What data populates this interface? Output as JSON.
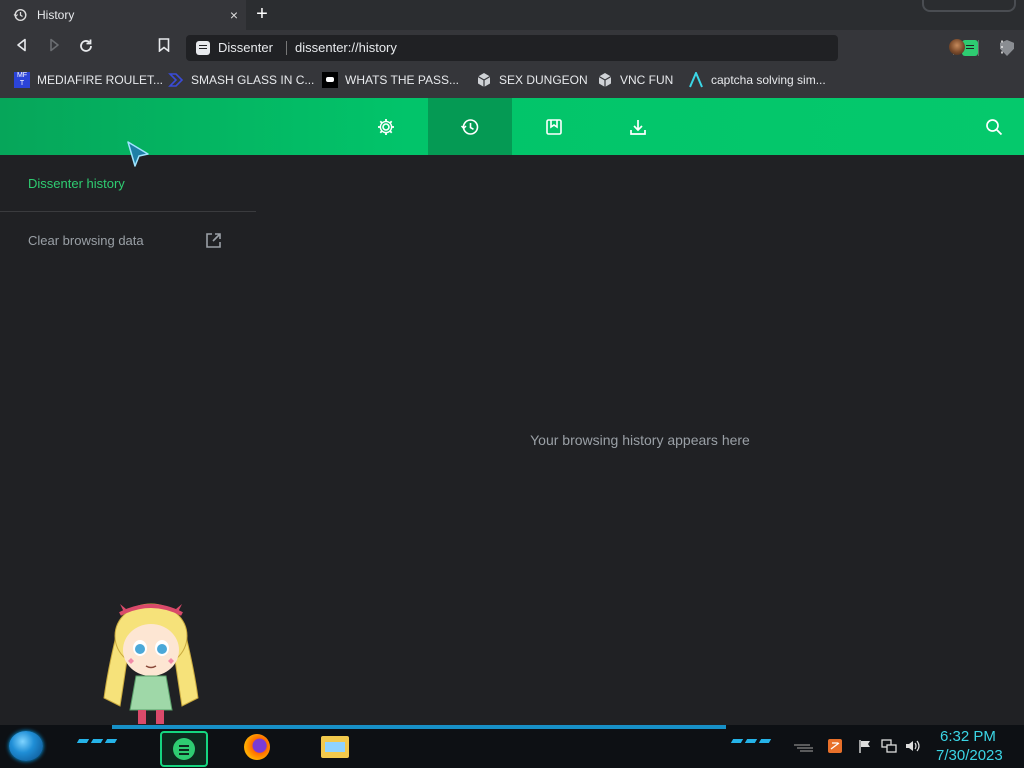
{
  "browser": {
    "tab": {
      "title": "History",
      "icon": "history-icon",
      "close": "×"
    },
    "new_tab": "+",
    "omnibox": {
      "site": "Dissenter",
      "url": "dissenter://history"
    },
    "menu": "⋮"
  },
  "bookmarks": [
    {
      "label": "MEDIAFIRE ROULET...",
      "icon": "mediafire-icon",
      "color": "#2b44d8"
    },
    {
      "label": "SMASH GLASS IN C...",
      "icon": "chevron-icon",
      "color": "#3a4bd8"
    },
    {
      "label": "WHATS THE PASS...",
      "icon": "discord-icon",
      "color": "#ffffff"
    },
    {
      "label": "SEX DUNGEON",
      "icon": "cube-icon",
      "color": "#cfd2d6"
    },
    {
      "label": "VNC FUN",
      "icon": "cube-icon",
      "color": "#cfd2d6"
    },
    {
      "label": "captcha solving sim...",
      "icon": "lambda-icon",
      "color": "#3bd6e6"
    }
  ],
  "header": {
    "tabs": [
      {
        "name": "settings",
        "icon": "gear-icon"
      },
      {
        "name": "history",
        "icon": "history-icon",
        "active": true
      },
      {
        "name": "bookmarks",
        "icon": "bookmark-icon"
      },
      {
        "name": "downloads",
        "icon": "download-icon"
      }
    ],
    "search_icon": "search-icon",
    "accent": "#05c96c"
  },
  "sidebar": {
    "title": "Dissenter history",
    "clear": "Clear browsing data"
  },
  "main": {
    "empty_message": "Your browsing history appears here"
  },
  "taskbar": {
    "apps": [
      "dissenter",
      "firefox",
      "file-explorer"
    ],
    "time": "6:32 PM",
    "date": "7/30/2023",
    "accent": "#3bd6e6"
  }
}
